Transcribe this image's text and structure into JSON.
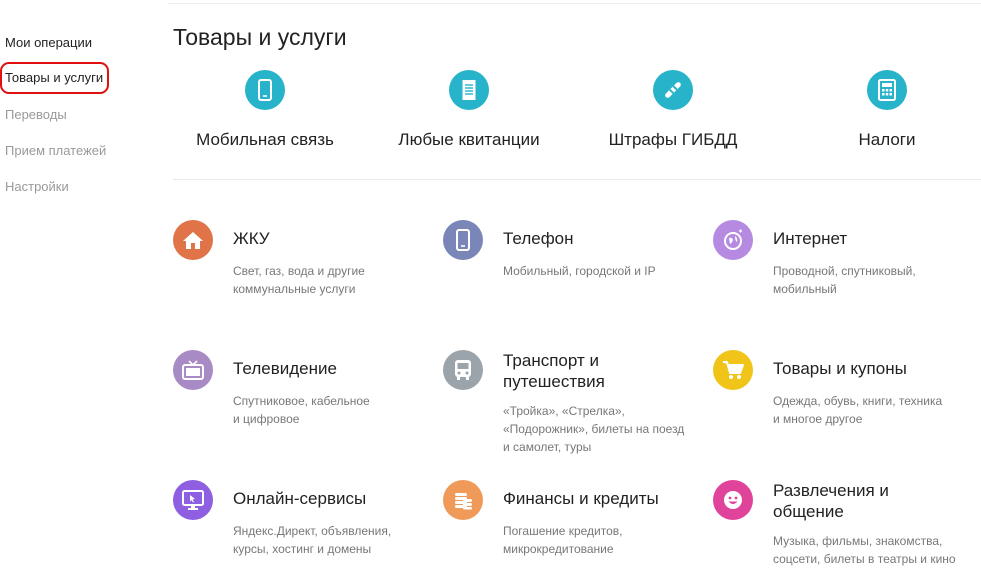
{
  "sidebar": {
    "items": [
      {
        "label": "Мои операции"
      },
      {
        "label": "Товары и услуги"
      },
      {
        "label": "Переводы"
      },
      {
        "label": "Прием платежей"
      },
      {
        "label": "Настройки"
      }
    ]
  },
  "page": {
    "title": "Товары и услуги"
  },
  "quick": [
    {
      "label": "Мобильная связь",
      "icon": "mobile-icon"
    },
    {
      "label": "Любые квитанции",
      "icon": "receipt-icon"
    },
    {
      "label": "Штрафы ГИБДД",
      "icon": "baton-icon"
    },
    {
      "label": "Налоги",
      "icon": "calculator-icon"
    }
  ],
  "categories": [
    {
      "title": "ЖКУ",
      "desc1": "Свет, газ, вода и другие",
      "desc2": "коммунальные услуги",
      "icon": "house-icon",
      "color": "#e07347"
    },
    {
      "title": "Телефон",
      "desc1": "Мобильный, городской и IP",
      "icon": "phone-icon",
      "color": "#7a86b8"
    },
    {
      "title": "Интернет",
      "desc1": "Проводной, спутниковый,",
      "desc2": "мобильный",
      "icon": "globe-icon",
      "color": "#b58ae0"
    },
    {
      "title": "Телевидение",
      "desc1": "Спутниковое, кабельное",
      "desc2": "и цифровое",
      "icon": "tv-icon",
      "color": "#a88bc4"
    },
    {
      "title1": "Транспорт и",
      "title2": "путешествия",
      "desc1": "«Тройка», «Стрелка»,",
      "desc2": "«Подорожник», билеты на поезд",
      "desc3": "и самолет, туры",
      "icon": "bus-icon",
      "color": "#9ba3ab"
    },
    {
      "title": "Товары и купоны",
      "desc1": "Одежда, обувь, книги, техника",
      "desc2": "и многое другое",
      "icon": "cart-icon",
      "color": "#f0c419"
    },
    {
      "title": "Онлайн-сервисы",
      "desc1": "Яндекс.Директ, объявления,",
      "desc2": "курсы, хостинг и домены",
      "icon": "monitor-icon",
      "color": "#8e5fe0"
    },
    {
      "title": "Финансы и кредиты",
      "desc1": "Погашение кредитов,",
      "desc2": "микрокредитование",
      "icon": "coins-icon",
      "color": "#f09a5a"
    },
    {
      "title1": "Развлечения и",
      "title2": "общение",
      "desc1": "Музыка, фильмы, знакомства,",
      "desc2": "соцсети, билеты в театры и кино",
      "icon": "smile-icon",
      "color": "#e0439a"
    }
  ]
}
